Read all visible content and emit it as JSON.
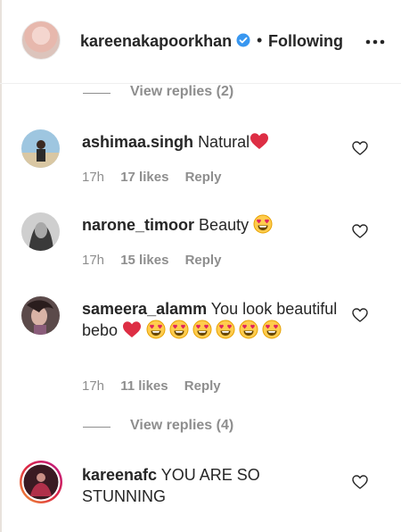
{
  "header": {
    "username": "kareenakapoorkhan",
    "separator": "•",
    "follow_status": "Following"
  },
  "view_replies_top": {
    "label": "View replies (2)"
  },
  "comments": [
    {
      "username": "ashimaa.singh",
      "text": "Natural",
      "time": "17h",
      "likes": "17 likes",
      "reply": "Reply"
    },
    {
      "username": "narone_timoor",
      "text": "Beauty",
      "time": "17h",
      "likes": "15 likes",
      "reply": "Reply"
    },
    {
      "username": "sameera_alamm",
      "text": "You look beautiful bebo",
      "time": "17h",
      "likes": "11 likes",
      "reply": "Reply"
    },
    {
      "username": "kareenafc",
      "text": "YOU ARE SO STUNNING"
    }
  ],
  "view_replies_bottom": {
    "label": "View replies (4)"
  },
  "colors": {
    "verified_blue": "#3897f0",
    "heart_red": "#ed4956",
    "muted_text": "#8e8e8e",
    "story_ring": "#d6249f"
  },
  "icons": [
    "verified-badge-icon",
    "more-options-icon",
    "like-heart-icon",
    "red-heart-emoji",
    "heart-eyes-emoji"
  ]
}
